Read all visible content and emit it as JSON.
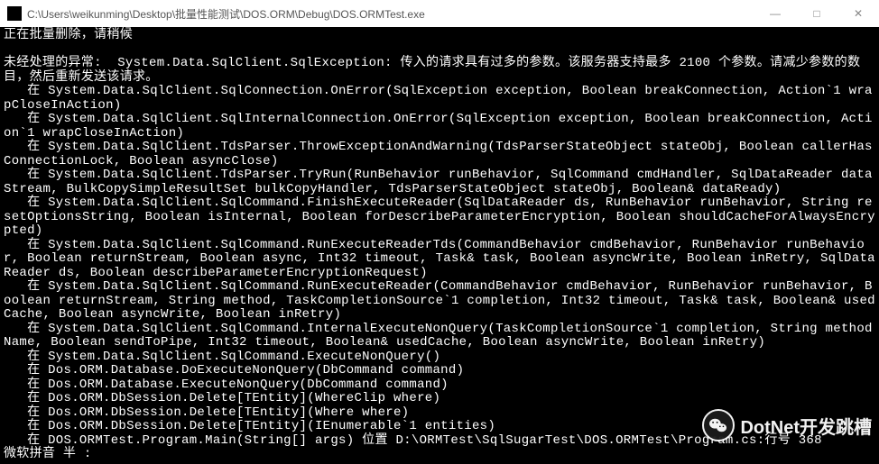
{
  "window": {
    "title": "C:\\Users\\weikunming\\Desktop\\批量性能测试\\DOS.ORM\\Debug\\DOS.ORMTest.exe",
    "minimize": "—",
    "maximize": "□",
    "close": "✕"
  },
  "console": {
    "lines": [
      "正在批量删除，请稍候",
      "",
      "未经处理的异常:  System.Data.SqlClient.SqlException: 传入的请求具有过多的参数。该服务器支持最多 2100 个参数。请减少参数的数目，然后重新发送该请求。",
      "   在 System.Data.SqlClient.SqlConnection.OnError(SqlException exception, Boolean breakConnection, Action`1 wrapCloseInAction)",
      "   在 System.Data.SqlClient.SqlInternalConnection.OnError(SqlException exception, Boolean breakConnection, Action`1 wrapCloseInAction)",
      "   在 System.Data.SqlClient.TdsParser.ThrowExceptionAndWarning(TdsParserStateObject stateObj, Boolean callerHasConnectionLock, Boolean asyncClose)",
      "   在 System.Data.SqlClient.TdsParser.TryRun(RunBehavior runBehavior, SqlCommand cmdHandler, SqlDataReader dataStream, BulkCopySimpleResultSet bulkCopyHandler, TdsParserStateObject stateObj, Boolean& dataReady)",
      "   在 System.Data.SqlClient.SqlCommand.FinishExecuteReader(SqlDataReader ds, RunBehavior runBehavior, String resetOptionsString, Boolean isInternal, Boolean forDescribeParameterEncryption, Boolean shouldCacheForAlwaysEncrypted)",
      "   在 System.Data.SqlClient.SqlCommand.RunExecuteReaderTds(CommandBehavior cmdBehavior, RunBehavior runBehavior, Boolean returnStream, Boolean async, Int32 timeout, Task& task, Boolean asyncWrite, Boolean inRetry, SqlDataReader ds, Boolean describeParameterEncryptionRequest)",
      "   在 System.Data.SqlClient.SqlCommand.RunExecuteReader(CommandBehavior cmdBehavior, RunBehavior runBehavior, Boolean returnStream, String method, TaskCompletionSource`1 completion, Int32 timeout, Task& task, Boolean& usedCache, Boolean asyncWrite, Boolean inRetry)",
      "   在 System.Data.SqlClient.SqlCommand.InternalExecuteNonQuery(TaskCompletionSource`1 completion, String methodName, Boolean sendToPipe, Int32 timeout, Boolean& usedCache, Boolean asyncWrite, Boolean inRetry)",
      "   在 System.Data.SqlClient.SqlCommand.ExecuteNonQuery()",
      "   在 Dos.ORM.Database.DoExecuteNonQuery(DbCommand command)",
      "   在 Dos.ORM.Database.ExecuteNonQuery(DbCommand command)",
      "   在 Dos.ORM.DbSession.Delete[TEntity](WhereClip where)",
      "   在 Dos.ORM.DbSession.Delete[TEntity](Where where)",
      "   在 Dos.ORM.DbSession.Delete[TEntity](IEnumerable`1 entities)",
      "   在 DOS.ORMTest.Program.Main(String[] args) 位置 D:\\ORMTest\\SqlSugarTest\\DOS.ORMTest\\Program.cs:行号 368",
      "微软拼音 半 :"
    ]
  },
  "watermark": {
    "text": "DotNet开发跳槽"
  }
}
